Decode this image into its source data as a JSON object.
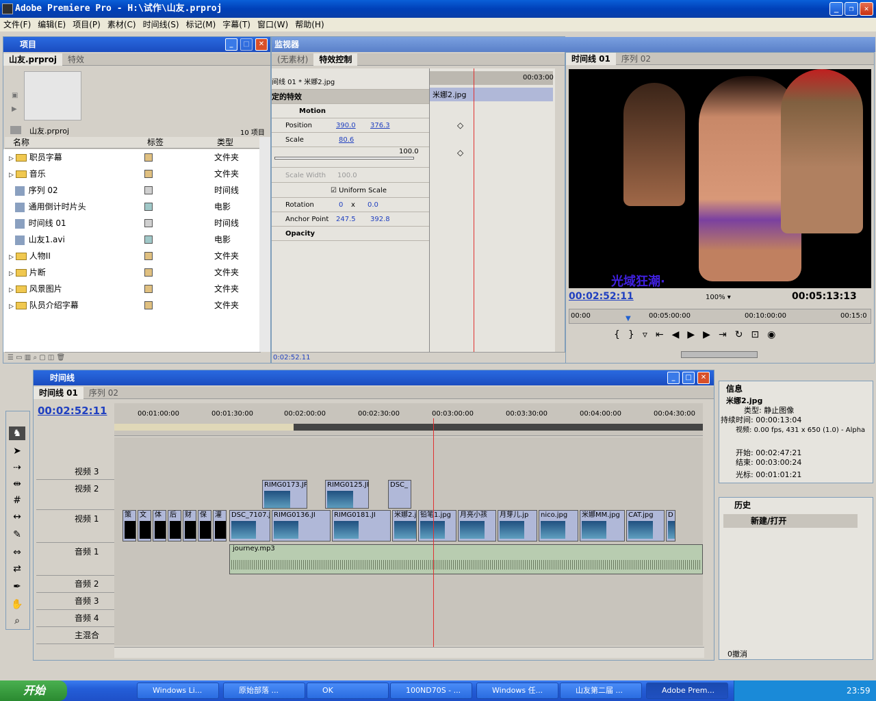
{
  "app": {
    "title": "Adobe Premiere Pro - H:\\试作\\山友.prproj"
  },
  "menu": [
    "文件(F)",
    "编辑(E)",
    "项目(P)",
    "素材(C)",
    "时间线(S)",
    "标记(M)",
    "字幕(T)",
    "窗口(W)",
    "帮助(H)"
  ],
  "project": {
    "title": "项目",
    "tabs": [
      "山友.prproj",
      "特效"
    ],
    "file": "山友.prproj",
    "count": "10 项目",
    "columns": [
      "名称",
      "标签",
      "类型"
    ],
    "items": [
      {
        "name": "职员字幕",
        "type": "文件夹",
        "kind": "folder",
        "color": "#e0c080"
      },
      {
        "name": "音乐",
        "type": "文件夹",
        "kind": "folder",
        "color": "#e0c080"
      },
      {
        "name": "序列 02",
        "type": "时间线",
        "kind": "seq",
        "color": "#d0d0d0"
      },
      {
        "name": "通用倒计时片头",
        "type": "电影",
        "kind": "movie",
        "color": "#a0c8c8"
      },
      {
        "name": "时间线 01",
        "type": "时间线",
        "kind": "seq",
        "color": "#d0d0d0"
      },
      {
        "name": "山友1.avi",
        "type": "电影",
        "kind": "movie",
        "color": "#a0c8c8"
      },
      {
        "name": "人物II",
        "type": "文件夹",
        "kind": "folder",
        "color": "#e0c080"
      },
      {
        "name": "片断",
        "type": "文件夹",
        "kind": "folder",
        "color": "#e0c080"
      },
      {
        "name": "风景图片",
        "type": "文件夹",
        "kind": "folder",
        "color": "#e0c080"
      },
      {
        "name": "队员介绍字幕",
        "type": "文件夹",
        "kind": "folder",
        "color": "#e0c080"
      }
    ]
  },
  "monitor": {
    "title": "监视器",
    "tabs": [
      "(无素材)",
      "特效控制"
    ],
    "ec": {
      "clip": "间线 01 * 米娜2.jpg",
      "time_end": "00:03:00",
      "clip_label": "米娜2.jpg",
      "fixed": "定的特效",
      "motion": "Motion",
      "position": "Position",
      "pos_x": "390.0",
      "pos_y": "376.3",
      "scale": "Scale",
      "scale_v": "80.6",
      "scale_max": "100.0",
      "scale_width": "Scale Width",
      "scale_width_v": "100.0",
      "uniform": "Uniform Scale",
      "rotation": "Rotation",
      "rot_a": "0",
      "rot_x": "x",
      "rot_b": "0.0",
      "anchor": "Anchor Point",
      "anc_x": "247.5",
      "anc_y": "392.8",
      "opacity": "Opacity",
      "bottom_time": "0:02:52.11"
    }
  },
  "program": {
    "tabs": [
      "时间线 01",
      "序列 02"
    ],
    "overlay_text": "光域狂潮·",
    "timecode": "00:02:52:11",
    "zoom": "100%",
    "duration": "00:05:13:13",
    "ruler": [
      "00:00",
      "00:05:00:00",
      "00:10:00:00",
      "00:15:0"
    ]
  },
  "timeline": {
    "title": "时间线",
    "tabs": [
      "时间线 01",
      "序列 02"
    ],
    "timecode": "00:02:52:11",
    "ruler": [
      "00:01:00:00",
      "00:01:30:00",
      "00:02:00:00",
      "00:02:30:00",
      "00:03:00:00",
      "00:03:30:00",
      "00:04:00:00",
      "00:04:30:00"
    ],
    "tracks": [
      "视频 3",
      "视频 2",
      "视频 1",
      "音频 1",
      "音频 2",
      "音频 3",
      "音频 4",
      "主混合"
    ],
    "v2_clips": [
      "RIMG0173.JPG",
      "RIMG0125.JP",
      "DSC_"
    ],
    "v1_titles": [
      "策",
      "文",
      "体",
      "后",
      "财",
      "保",
      "灌"
    ],
    "v1_clips": [
      "DSC_7107.J",
      "RIMG0136.JI",
      "RIMG0181.JI",
      "米娜2.jpg",
      "铅笔1.jpg",
      "月亮小孩",
      "月芽儿.jp",
      "nico.jpg",
      "米娜MM.jpg",
      "CAT.jpg",
      "D"
    ],
    "audio_clip": "journey.mp3"
  },
  "info": {
    "title": "信息",
    "name": "米娜2.jpg",
    "type_l": "类型:",
    "type_v": "静止图像",
    "dur_l": "持续时间:",
    "dur_v": "00:00:13:04",
    "video_l": "视频:",
    "video_v": "0.00 fps, 431 x 650 (1.0) - Alpha",
    "in_l": "开始:",
    "in_v": "00:02:47:21",
    "out_l": "结束:",
    "out_v": "00:03:00:24",
    "cur_l": "光标:",
    "cur_v": "00:01:01:21"
  },
  "history": {
    "title": "历史",
    "item": "新建/打开",
    "undo": "0撤消"
  },
  "taskbar": {
    "start": "开始",
    "items": [
      "Windows Li...",
      "原始部落 ...",
      "OK",
      "100ND70S - ...",
      "Windows 任...",
      "山友第二届 ...",
      "Adobe Prem..."
    ],
    "clock": "23:59"
  }
}
